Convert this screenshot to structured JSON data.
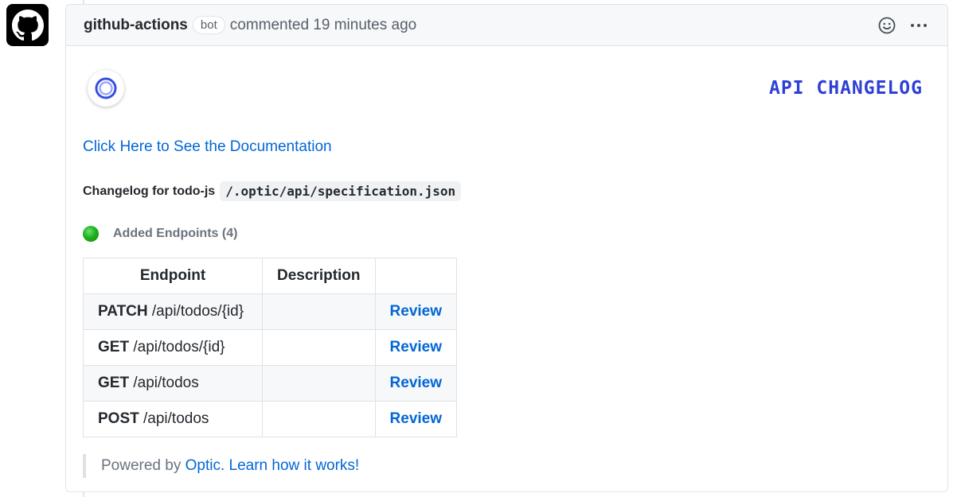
{
  "comment": {
    "author": "github-actions",
    "badge": "bot",
    "meta": "commented 19 minutes ago",
    "avatar_icon": "github-octocat-icon",
    "actions": {
      "reaction_icon": "smiley-icon",
      "more_icon": "kebab-horizontal-icon"
    }
  },
  "body": {
    "logo_icon": "optic-logo-icon",
    "title": "API CHANGELOG",
    "doc_link": "Click Here to See the Documentation",
    "changelog_prefix": "Changelog for todo-js",
    "spec_path": "/.optic/api/specification.json",
    "added_label": "Added Endpoints (4)",
    "colors": {
      "title": "#2f3fd6",
      "link": "#0366d6",
      "status_green": "#1db31d"
    }
  },
  "table": {
    "headers": [
      "Endpoint",
      "Description",
      ""
    ],
    "rows": [
      {
        "method": "PATCH",
        "path": "/api/todos/{id}",
        "description": "",
        "action": "Review"
      },
      {
        "method": "GET",
        "path": "/api/todos/{id}",
        "description": "",
        "action": "Review"
      },
      {
        "method": "GET",
        "path": "/api/todos",
        "description": "",
        "action": "Review"
      },
      {
        "method": "POST",
        "path": "/api/todos",
        "description": "",
        "action": "Review"
      }
    ]
  },
  "footer": {
    "prefix": "Powered by",
    "optic_link": "Optic.",
    "learn_link": "Learn how it works!"
  }
}
